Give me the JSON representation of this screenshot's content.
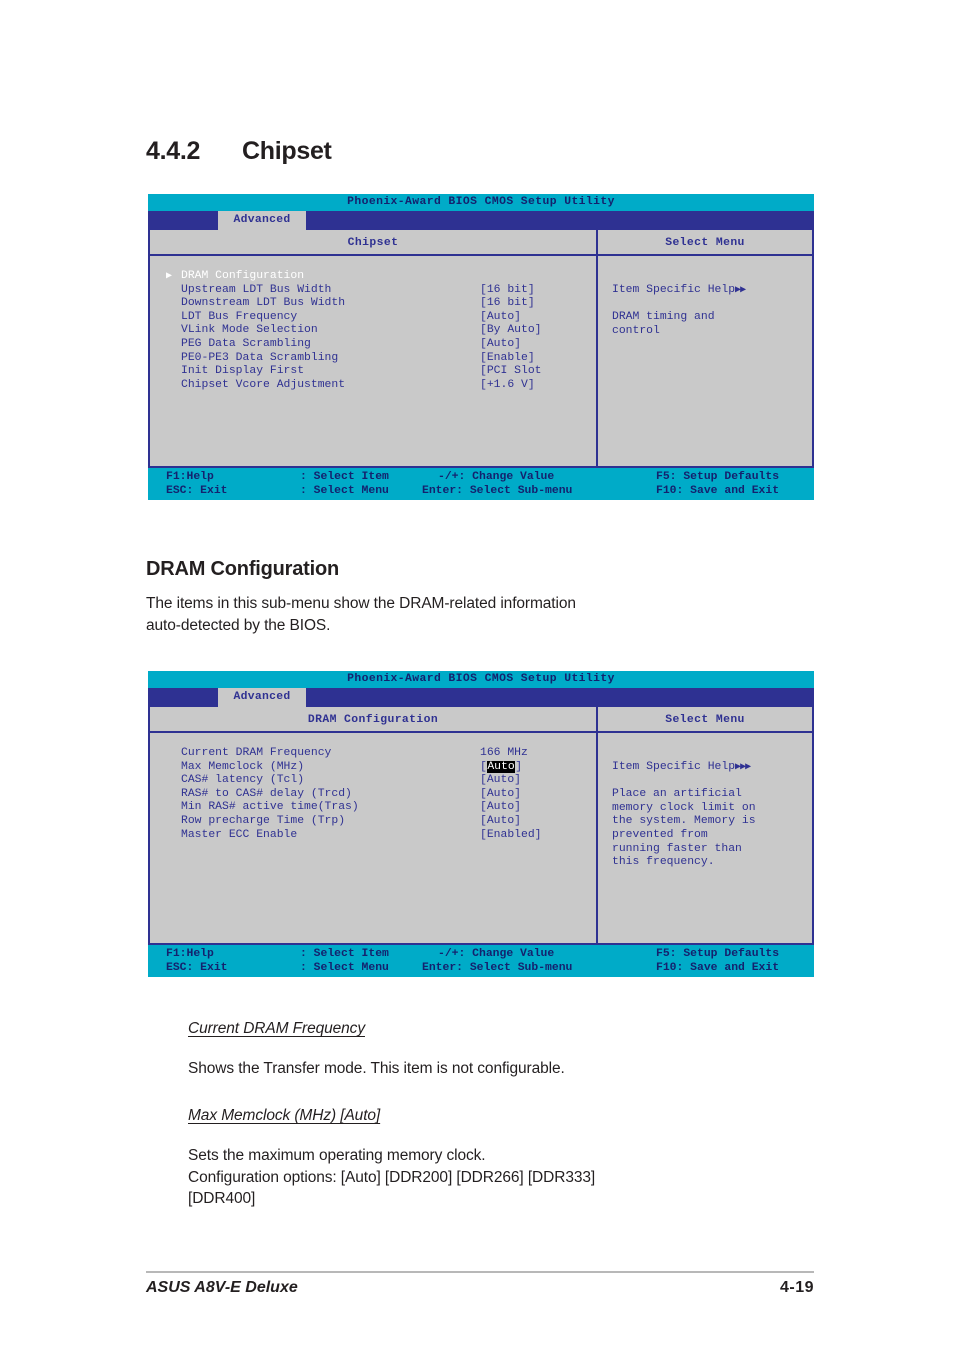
{
  "section": {
    "number": "4.4.2",
    "title": "Chipset"
  },
  "bios_screen_1": {
    "title": "Phoenix-Award BIOS CMOS Setup Utility",
    "tab": "Advanced",
    "panel_title": "Chipset",
    "help_panel_title": "Select Menu",
    "help_heading": "Item Specific Help",
    "help_arrows": "▶▶",
    "help_lines": [
      "DRAM timing and",
      "control"
    ],
    "items": [
      {
        "label": "DRAM Configuration",
        "value": "",
        "submenu": true,
        "selected": true
      },
      {
        "label": "Upstream LDT Bus Width",
        "value": "[16 bit]",
        "submenu": false,
        "selected": false
      },
      {
        "label": "Downstream LDT Bus Width",
        "value": "[16 bit]",
        "submenu": false,
        "selected": false
      },
      {
        "label": "LDT Bus Frequency",
        "value": "[Auto]",
        "submenu": false,
        "selected": false
      },
      {
        "label": "VLink Mode Selection",
        "value": "[By Auto]",
        "submenu": false,
        "selected": false
      },
      {
        "label": "PEG Data Scrambling",
        "value": "[Auto]",
        "submenu": false,
        "selected": false
      },
      {
        "label": "PE0-PE3 Data Scrambling",
        "value": "[Enable]",
        "submenu": false,
        "selected": false
      },
      {
        "label": "Init Display First",
        "value": "[PCI Slot",
        "submenu": false,
        "selected": false
      },
      {
        "label": "Chipset Vcore Adjustment",
        "value": "[+1.6 V]",
        "submenu": false,
        "selected": false
      }
    ],
    "footer": {
      "f1": "F1:Help",
      "esc": "ESC: Exit",
      "select_item": ": Select Item",
      "select_menu": ": Select Menu",
      "change_value": "-/+: Change Value",
      "select_submenu": "Enter: Select Sub-menu",
      "setup_defaults": "F5: Setup Defaults",
      "save_exit": "F10: Save and Exit"
    }
  },
  "dram_config_heading": "DRAM Configuration",
  "dram_config_body_line1": "The items in this sub-menu show the DRAM-related information",
  "dram_config_body_line2": "auto-detected by the BIOS.",
  "bios_screen_2": {
    "title": "Phoenix-Award BIOS CMOS Setup Utility",
    "tab": "Advanced",
    "panel_title": "DRAM Configuration",
    "help_panel_title": "Select Menu",
    "help_heading": "Item Specific Help",
    "help_arrows": "▶▶▶",
    "help_lines": [
      "Place an artificial",
      "memory clock limit on",
      "the system. Memory is",
      "prevented from",
      "running faster than",
      "this frequency."
    ],
    "items": [
      {
        "label": "Current DRAM Frequency",
        "value": "166 MHz",
        "highlight": false
      },
      {
        "label": "Max Memclock (MHz)",
        "value": "Auto",
        "highlight": true
      },
      {
        "label": "CAS# latency (Tcl)",
        "value": "[Auto]",
        "highlight": false
      },
      {
        "label": "RAS# to CAS# delay  (Trcd)",
        "value": "[Auto]",
        "highlight": false
      },
      {
        "label": "Min RAS# active time(Tras)",
        "value": "[Auto]",
        "highlight": false
      },
      {
        "label": "Row precharge Time  (Trp)",
        "value": "[Auto]",
        "highlight": false
      },
      {
        "label": "Master ECC Enable",
        "value": "[Enabled]",
        "highlight": false
      }
    ],
    "footer": {
      "f1": "F1:Help",
      "esc": "ESC: Exit",
      "select_item": ": Select Item",
      "select_menu": ": Select Menu",
      "change_value": "-/+: Change Value",
      "select_submenu": "Enter: Select Sub-menu",
      "setup_defaults": "F5: Setup Defaults",
      "save_exit": "F10: Save and Exit"
    }
  },
  "topic_current_dram": {
    "heading": "Current DRAM Frequency",
    "body": "Shows the Transfer mode. This item is not configurable."
  },
  "topic_max_memclock": {
    "heading": "Max Memclock (MHz) [Auto]",
    "body_line1": "Sets the maximum operating memory clock.",
    "body_line2": "Configuration options: [Auto] [DDR200] [DDR266] [DDR333]",
    "body_line3": "[DDR400]"
  },
  "page_footer": {
    "left": "ASUS A8V-E Deluxe",
    "right": "4-19"
  },
  "colors": {
    "teal": "#00abc8",
    "navy": "#2e3192",
    "gray": "#c9c9c9",
    "text_blue": "#2f3192"
  }
}
